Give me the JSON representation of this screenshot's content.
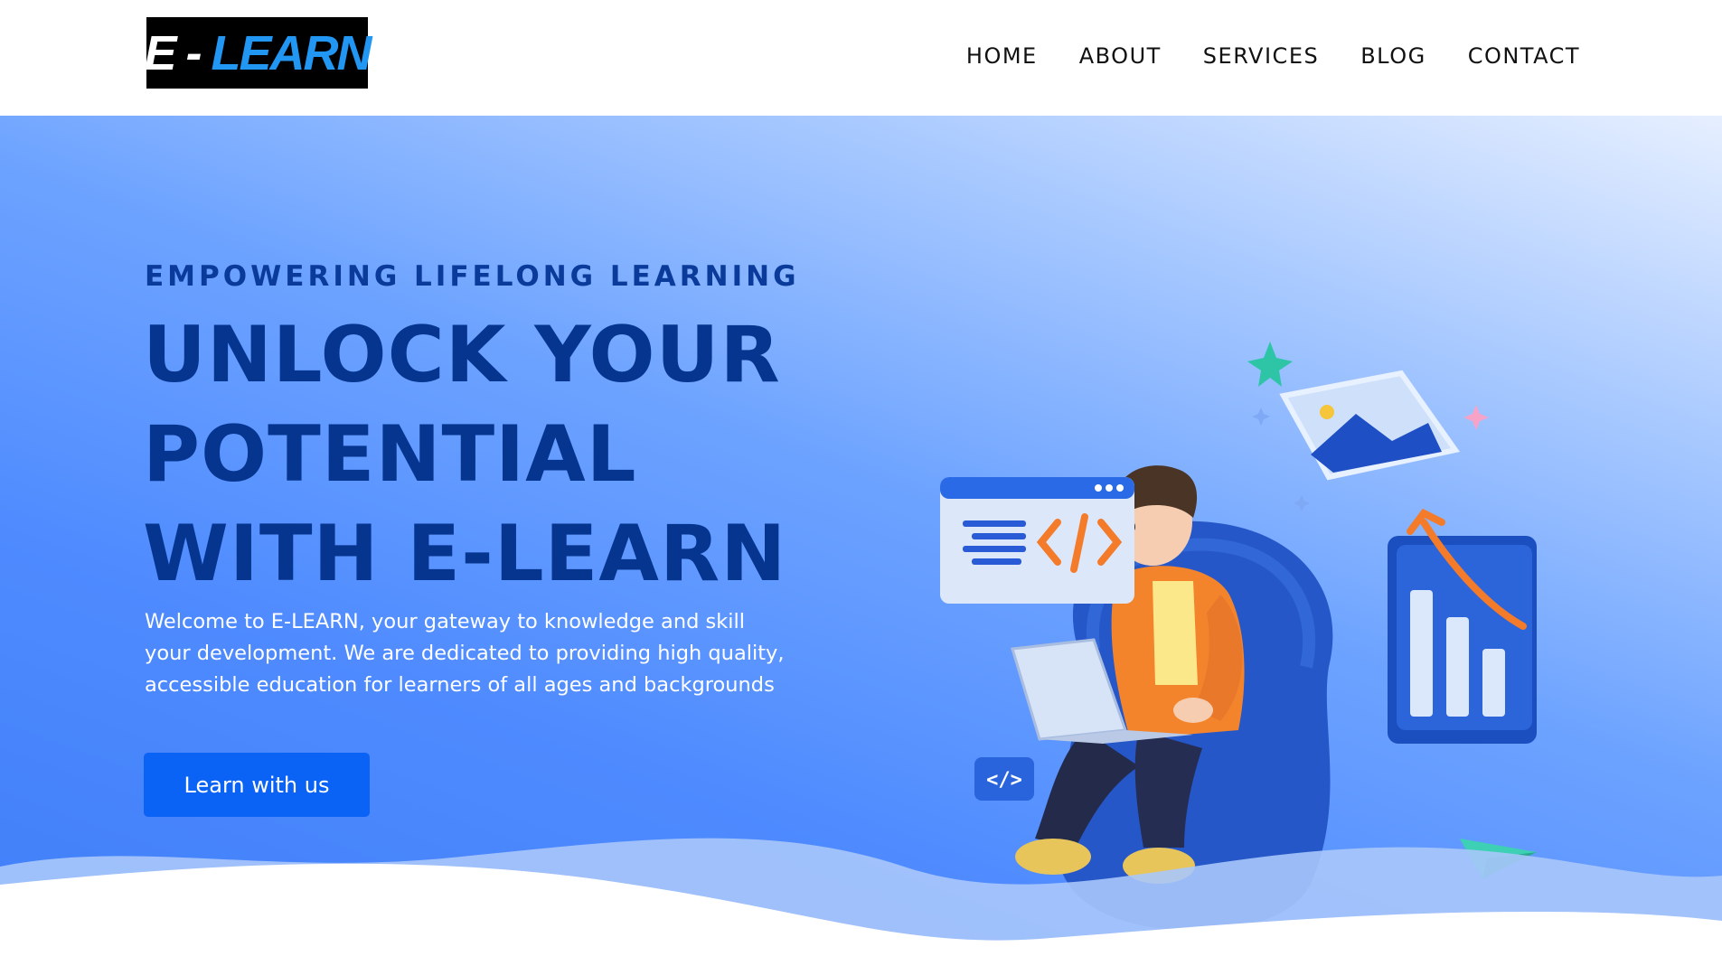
{
  "logo": {
    "part1": "E",
    "dash": "-",
    "part2": "LEARN"
  },
  "nav": {
    "items": [
      {
        "label": "HOME"
      },
      {
        "label": "ABOUT"
      },
      {
        "label": "SERVICES"
      },
      {
        "label": "BLOG"
      },
      {
        "label": "CONTACT"
      }
    ]
  },
  "hero": {
    "eyebrow": "EMPOWERING LIFELONG LEARNING",
    "headline": [
      "UNLOCK YOUR",
      "POTENTIAL",
      "WITH E-LEARN"
    ],
    "intro": [
      "Welcome to E-LEARN, your gateway to knowledge and skill",
      "your development. We are dedicated to providing high quality,",
      "accessible education for learners of all ages and backgrounds"
    ],
    "cta_label": "Learn with us",
    "code_badge": "</>"
  },
  "colors": {
    "brand_blue": "#2196f3",
    "headline_navy": "#06358f",
    "button_blue": "#0a63f5"
  },
  "icons": [
    "code-window-icon",
    "image-card-icon",
    "bar-chart-icon",
    "code-badge-icon",
    "paper-plane-icon",
    "sparkle-icon"
  ]
}
